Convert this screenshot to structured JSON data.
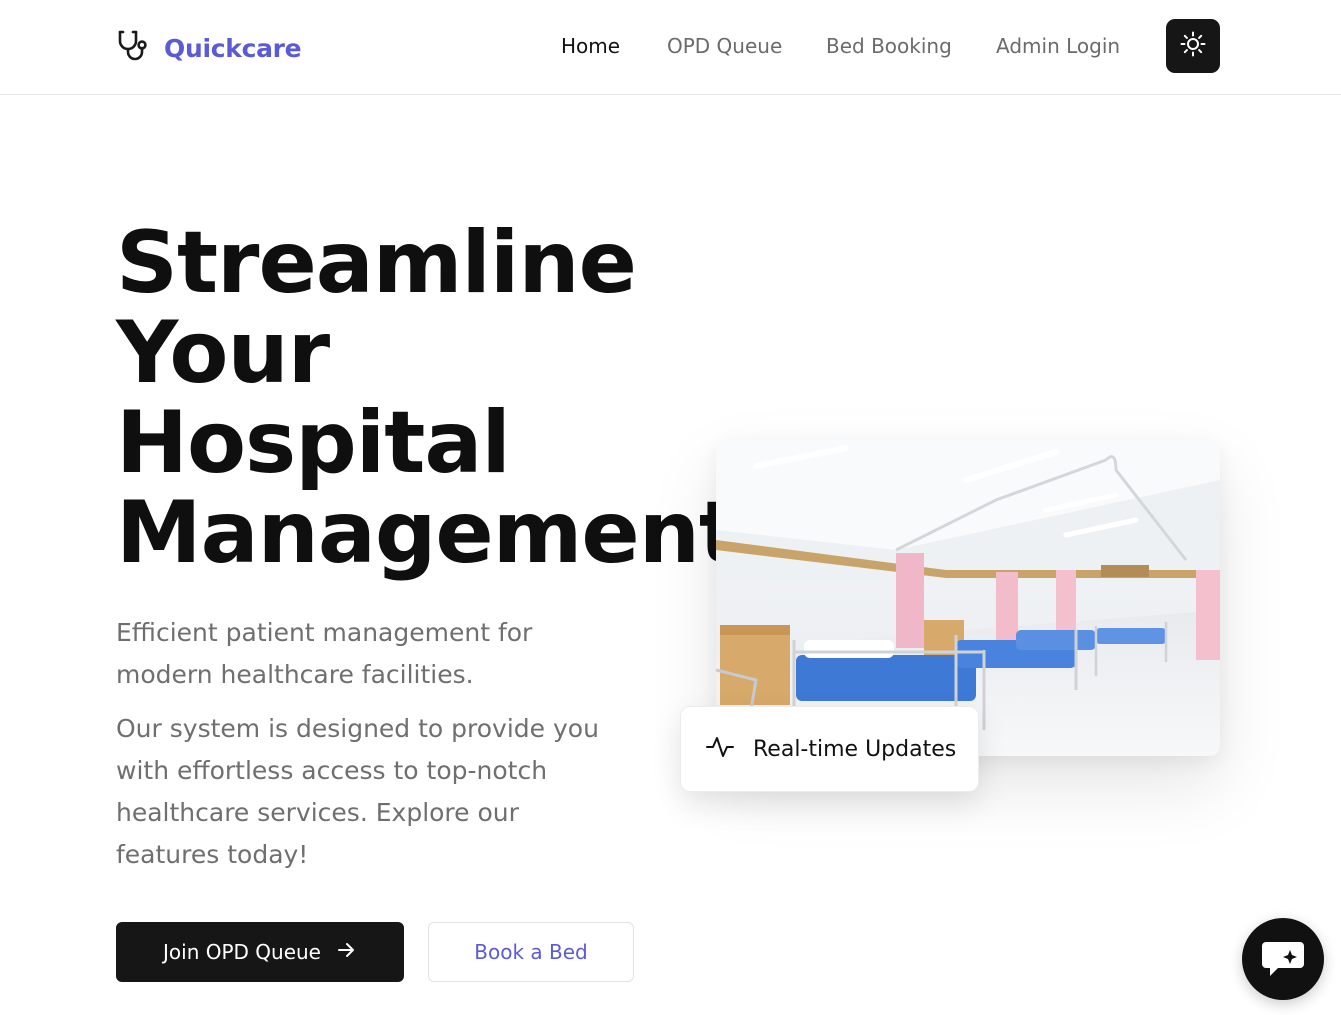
{
  "brand": {
    "name": "Quickcare",
    "icon": "stethoscope-icon",
    "color": "#5b5bd6"
  },
  "nav": {
    "links": [
      {
        "label": "Home",
        "active": true
      },
      {
        "label": "OPD Queue",
        "active": false
      },
      {
        "label": "Bed Booking",
        "active": false
      },
      {
        "label": "Admin Login",
        "active": false
      }
    ],
    "theme_toggle_icon": "sun-icon"
  },
  "hero": {
    "title_lines": [
      "Streamline",
      "Your",
      "Hospital",
      "Management"
    ],
    "subtitle": "Efficient patient management for modern healthcare facilities.",
    "description": "Our system is designed to provide you with effortless access to top-notch healthcare services. Explore our features today!",
    "primary_button": {
      "label": "Join OPD Queue",
      "icon": "arrow-right-icon"
    },
    "secondary_button": {
      "label": "Book a Bed"
    },
    "image": {
      "subject": "hospital-ward-photo"
    },
    "badge": {
      "label": "Real-time Updates",
      "icon": "activity-icon"
    }
  },
  "chat": {
    "icon": "chat-sparkle-icon"
  },
  "colors": {
    "accent": "#5b5bd6",
    "dark": "#161616",
    "muted_text": "#6f6f6f"
  }
}
